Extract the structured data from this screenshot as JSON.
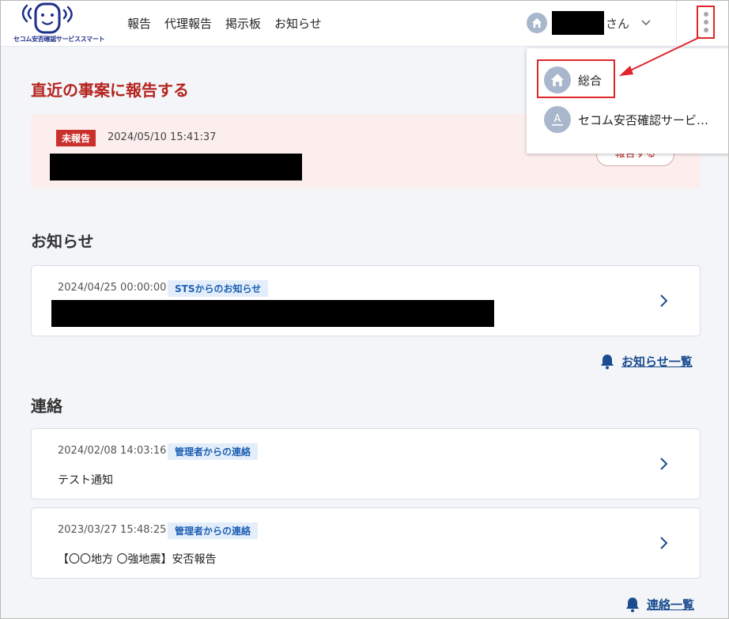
{
  "header": {
    "logo_text": "セコム安否確認サービススマート",
    "nav": [
      "報告",
      "代理報告",
      "掲示板",
      "お知らせ"
    ],
    "user_suffix": "さん"
  },
  "report_section": {
    "title": "直近の事案に報告する",
    "badge": "未報告",
    "datetime": "2024/05/10 15:41:37",
    "button_label": "報告する"
  },
  "news_section": {
    "title": "お知らせ",
    "items": [
      {
        "datetime": "2024/04/25 00:00:00",
        "tag": "STSからのお知らせ"
      }
    ],
    "more_link": "お知らせ一覧"
  },
  "contact_section": {
    "title": "連絡",
    "items": [
      {
        "datetime": "2024/02/08 14:03:16",
        "tag": "管理者からの連絡",
        "title": "テスト通知"
      },
      {
        "datetime": "2023/03/27 15:48:25",
        "tag": "管理者からの連絡",
        "title": "【〇〇地方 〇強地震】安否報告"
      }
    ],
    "more_link": "連絡一覧"
  },
  "dropdown": {
    "items": [
      {
        "label": "総合",
        "icon": "home-icon"
      },
      {
        "label": "セコム安否確認サービ…",
        "icon": "letter-a-icon",
        "letter": "A"
      }
    ]
  },
  "colors": {
    "accent_red": "#b5241f",
    "badge_red": "#c9302c",
    "link_blue": "#1a4c8f",
    "tag_blue": "#1d5fb3",
    "highlight_red": "#e0262a"
  }
}
